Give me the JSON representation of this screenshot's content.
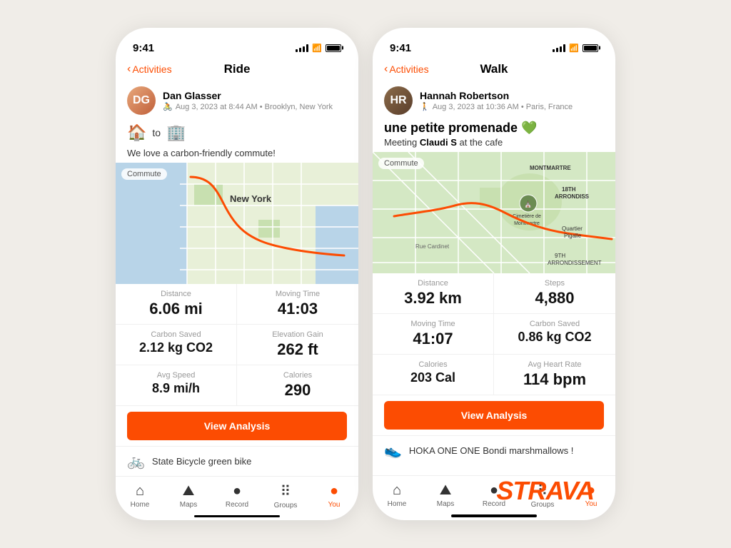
{
  "phone1": {
    "statusBar": {
      "time": "9:41",
      "icons": "signal wifi battery"
    },
    "navHeader": {
      "backLabel": "Activities",
      "title": "Ride"
    },
    "user": {
      "name": "Dan Glasser",
      "meta": "Aug 3, 2023 at 8:44 AM • Brooklyn, New York",
      "initials": "DG"
    },
    "routeFrom": "🏠",
    "routeTo": "🏢",
    "description": "We love a carbon-friendly commute!",
    "mapLabel": "Commute",
    "stats": [
      {
        "label": "Distance",
        "value": "6.06 mi"
      },
      {
        "label": "Moving Time",
        "value": "41:03"
      },
      {
        "label": "Carbon Saved",
        "value": "2.12 kg CO2"
      },
      {
        "label": "Elevation Gain",
        "value": "262 ft"
      },
      {
        "label": "Avg Speed",
        "value": "8.9 mi/h"
      },
      {
        "label": "Calories",
        "value": "290"
      }
    ],
    "viewAnalysis": "View Analysis",
    "equipment": "State Bicycle green bike",
    "tabs": [
      {
        "label": "Home",
        "icon": "🏠",
        "active": false
      },
      {
        "label": "Maps",
        "icon": "🗺",
        "active": false
      },
      {
        "label": "Record",
        "icon": "⏺",
        "active": false
      },
      {
        "label": "Groups",
        "icon": "👥",
        "active": false
      },
      {
        "label": "You",
        "icon": "👤",
        "active": true
      }
    ]
  },
  "phone2": {
    "statusBar": {
      "time": "9:41",
      "icons": "signal wifi battery"
    },
    "navHeader": {
      "backLabel": "Activities",
      "title": "Walk"
    },
    "user": {
      "name": "Hannah Robertson",
      "meta": "Aug 3, 2023 at 10:36 AM • Paris, France",
      "initials": "HR"
    },
    "activityTitle": "une petite promenade 💚",
    "activitySubtitle": "Meeting Claudi S at the cafe",
    "mapLabel": "Commute",
    "stats": [
      {
        "label": "Distance",
        "value": "3.92 km"
      },
      {
        "label": "Steps",
        "value": "4,880"
      },
      {
        "label": "Moving Time",
        "value": "41:07"
      },
      {
        "label": "Carbon Saved",
        "value": "0.86 kg CO2"
      },
      {
        "label": "Calories",
        "value": "203 Cal"
      },
      {
        "label": "Avg Heart Rate",
        "value": "114 bpm"
      }
    ],
    "viewAnalysis": "View Analysis",
    "equipment": "HOKA ONE ONE Bondi marshmallows !",
    "tabs": [
      {
        "label": "Home",
        "icon": "🏠",
        "active": false
      },
      {
        "label": "Maps",
        "icon": "🗺",
        "active": false
      },
      {
        "label": "Record",
        "icon": "⏺",
        "active": false
      },
      {
        "label": "Groups",
        "icon": "👥",
        "active": false
      },
      {
        "label": "You",
        "icon": "👤",
        "active": true
      }
    ]
  },
  "brand": "STRAVA"
}
